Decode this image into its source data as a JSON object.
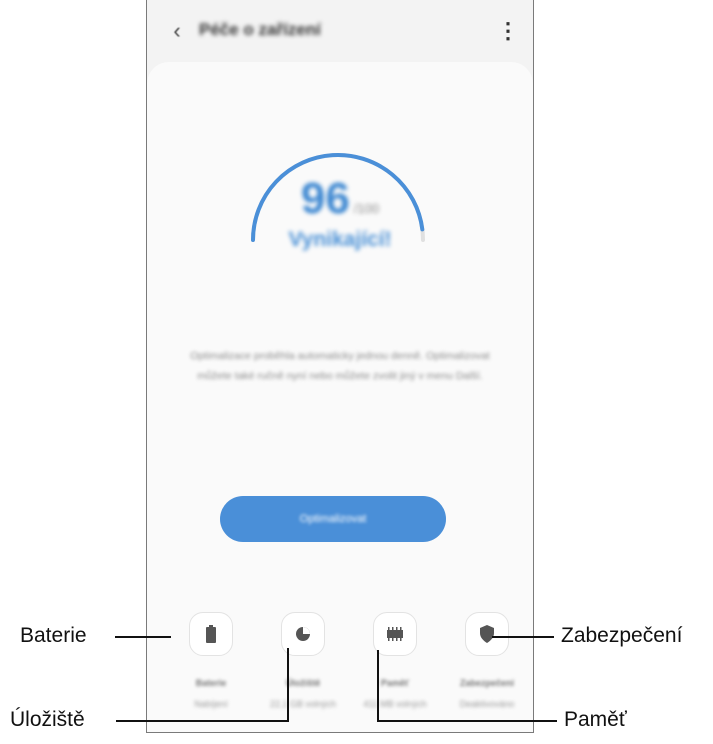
{
  "header": {
    "title": "Péče o zařízení",
    "back_icon": "chevron-left-icon",
    "more_icon": "more-vert-icon"
  },
  "score": {
    "value": "96",
    "max": "/100",
    "label": "Vynikající!",
    "fraction": 0.96,
    "accent": "#4a8fd8"
  },
  "description": "Optimalizace proběhla automaticky jednou denně. Optimalizovat můžete také ručně nyní nebo můžete zvolit jiný v menu Další.",
  "optimize_button": {
    "label": "Optimalizovat"
  },
  "features": [
    {
      "name": "Baterie",
      "status": "Nabíjení",
      "icon": "battery-icon"
    },
    {
      "name": "Úložiště",
      "status": "22,1 GB volných",
      "icon": "storage-pie-icon"
    },
    {
      "name": "Paměť",
      "status": "411 MB volných",
      "icon": "memory-chip-icon"
    },
    {
      "name": "Zabezpečení",
      "status": "Deaktivováno",
      "icon": "shield-icon"
    }
  ],
  "callouts": {
    "battery": "Baterie",
    "storage": "Úložiště",
    "memory": "Paměť",
    "security": "Zabezpečení"
  }
}
